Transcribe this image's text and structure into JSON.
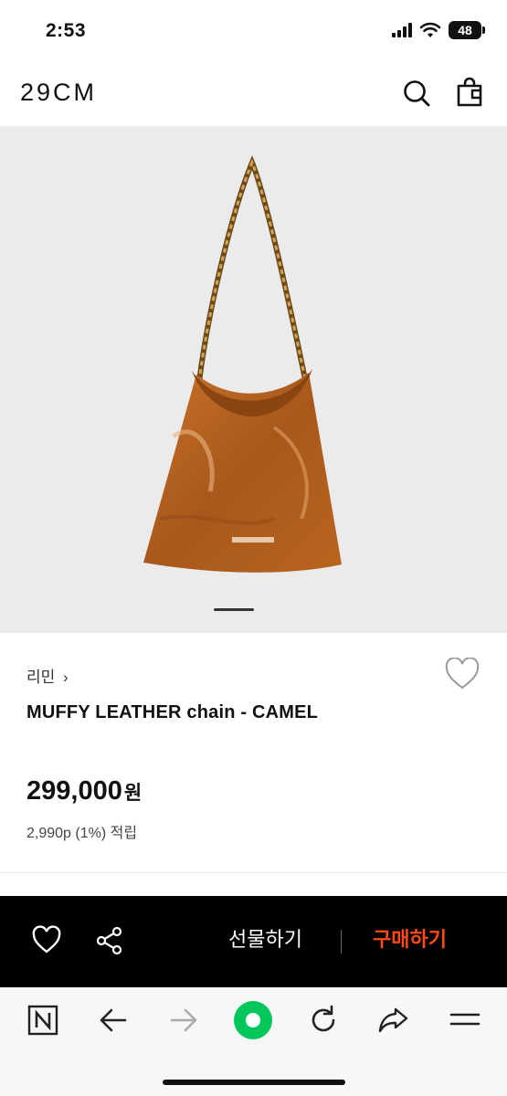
{
  "status_bar": {
    "time": "2:53",
    "battery": "48",
    "icons": [
      "cellular-signal-icon",
      "wifi-icon",
      "battery-icon"
    ]
  },
  "header": {
    "logo": "29CM",
    "icons": [
      "search-icon",
      "shopping-bag-icon"
    ]
  },
  "product": {
    "image_description_icon": "camel-leather-chain-bag-image",
    "brand": "리민",
    "brand_chevron": "›",
    "name": "MUFFY LEATHER chain - CAMEL",
    "price": "299,000",
    "price_unit": "원",
    "points": "2,990p (1%) 적립"
  },
  "action_bar": {
    "gift_label": "선물하기",
    "buy_label": "구매하기",
    "colors": {
      "background": "#000000",
      "buy": "#ff4a14",
      "gift": "#ffffff"
    }
  },
  "browser_toolbar": {
    "icons": [
      "naver-n-icon",
      "back-arrow-icon",
      "forward-arrow-icon",
      "green-home-icon",
      "reload-icon",
      "share-arrow-icon",
      "menu-icon"
    ],
    "accent": "#03c75a"
  }
}
